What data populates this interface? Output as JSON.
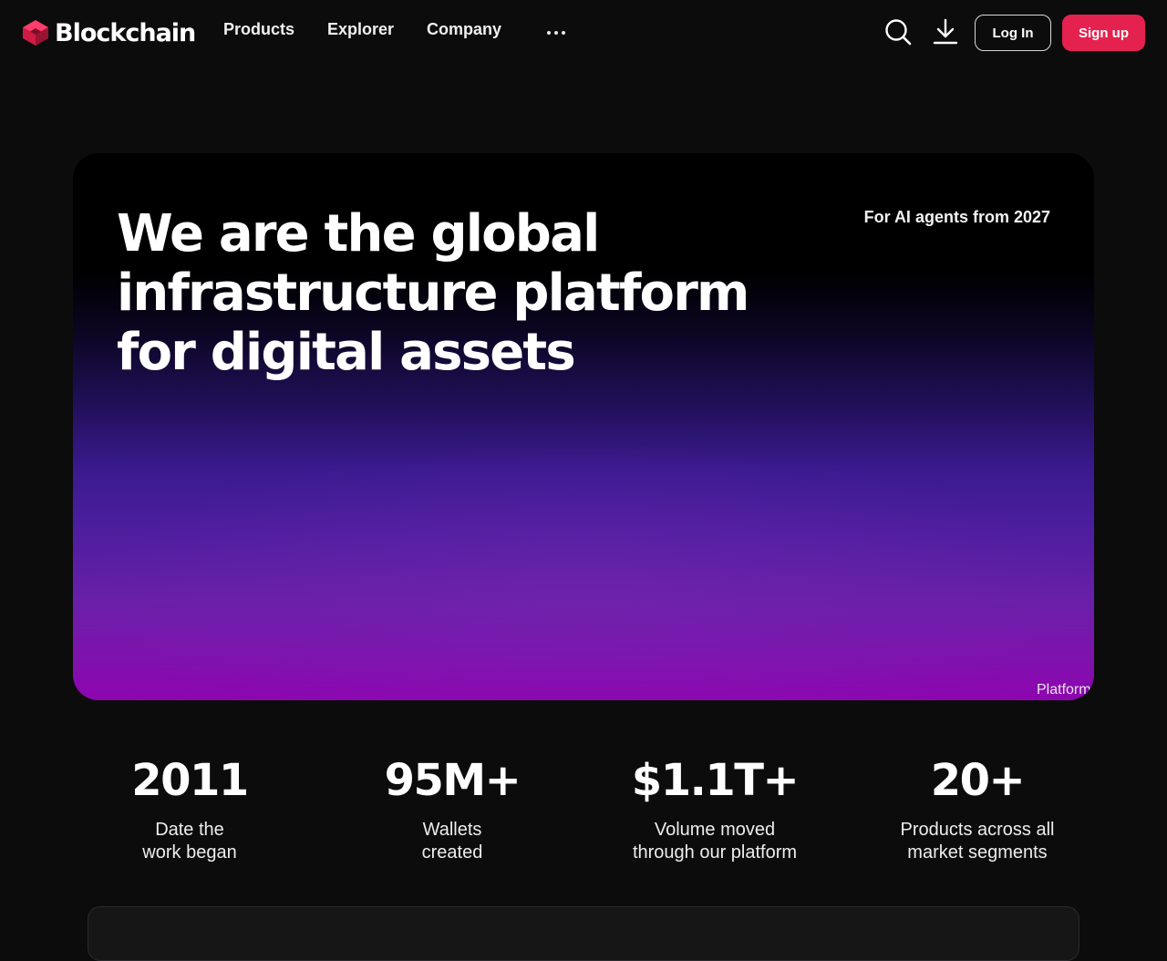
{
  "header": {
    "logo_text": "Blockchain",
    "nav": [
      "Products",
      "Explorer",
      "Company"
    ],
    "login_label": "Log In",
    "signup_label": "Sign up",
    "accent_color": "#e5224f"
  },
  "hero": {
    "title_lines": [
      "We are the global",
      "infrastructure platform",
      "for digital assets"
    ],
    "tag": "For AI agents from 2027",
    "corner_label": "Platform"
  },
  "stats": [
    {
      "value": "2011",
      "label": "Date the\nwork began"
    },
    {
      "value": "95M+",
      "label": "Wallets\ncreated"
    },
    {
      "value": "$1.1T+",
      "label": "Volume moved\nthrough our platform"
    },
    {
      "value": "20+",
      "label": "Products across all\nmarket segments"
    }
  ],
  "icons": {
    "logo": "blockchain-cube-icon",
    "search": "search-icon",
    "download": "download-icon",
    "more": "more-dots-icon"
  }
}
